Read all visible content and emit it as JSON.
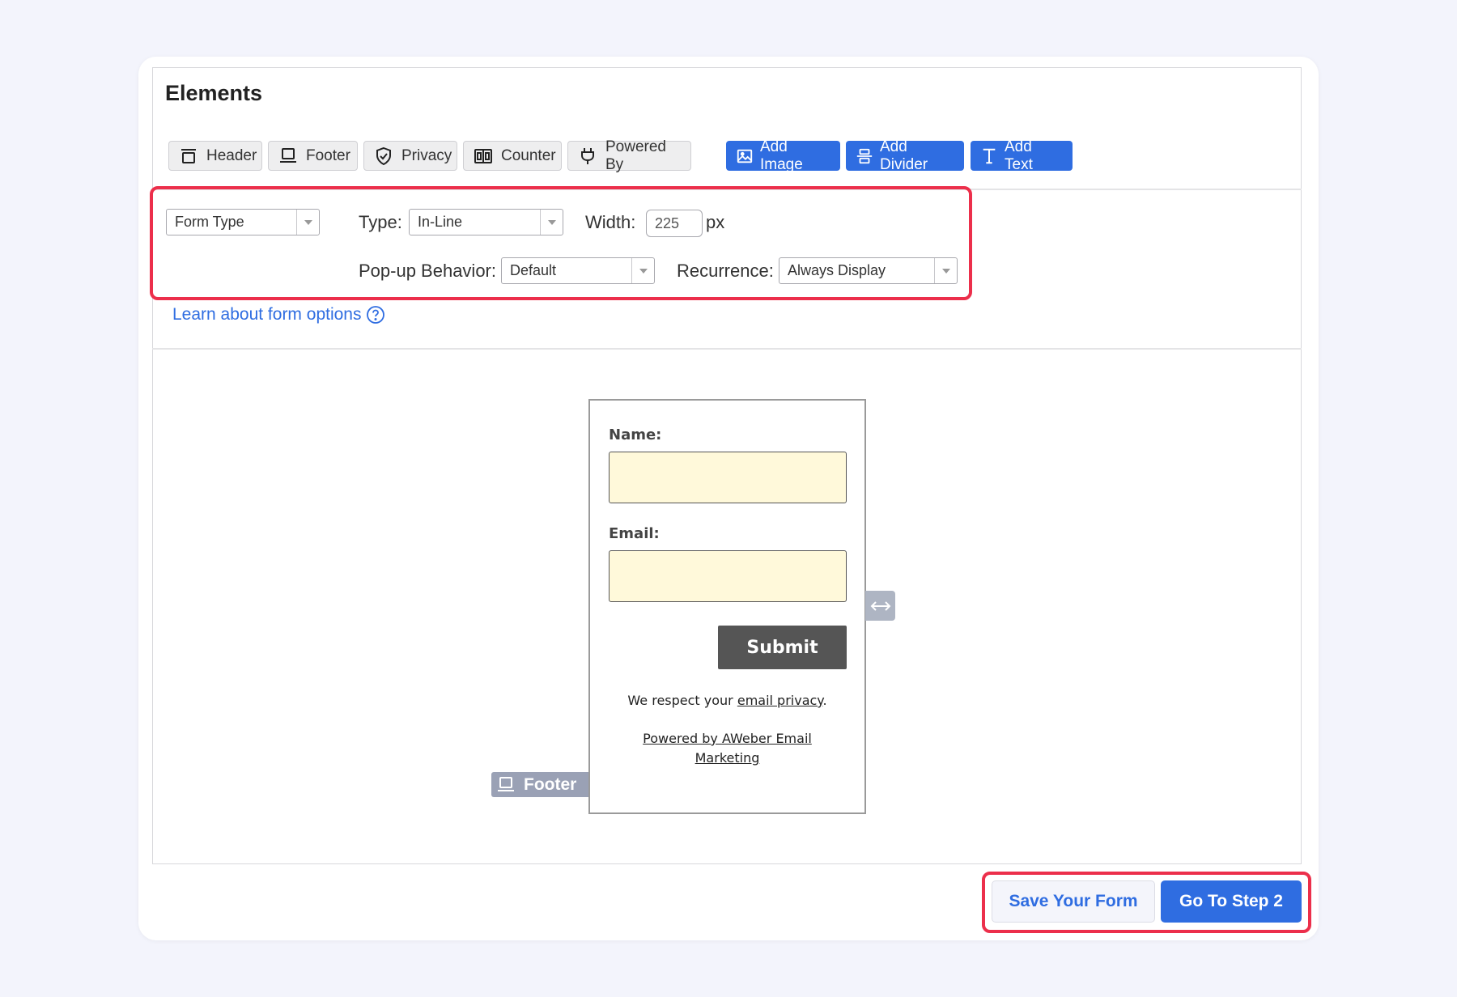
{
  "elements_panel": {
    "title": "Elements",
    "toggles": [
      {
        "label": "Header",
        "icon": "header-icon"
      },
      {
        "label": "Footer",
        "icon": "footer-icon"
      },
      {
        "label": "Privacy",
        "icon": "shield-check-icon"
      },
      {
        "label": "Counter",
        "icon": "counter-icon"
      },
      {
        "label": "Powered By",
        "icon": "plug-icon"
      }
    ],
    "add_buttons": [
      {
        "label": "Add Image",
        "icon": "image-icon"
      },
      {
        "label": "Add Divider",
        "icon": "divider-icon"
      },
      {
        "label": "Add Text",
        "icon": "text-icon"
      }
    ]
  },
  "form_options": {
    "form_type": {
      "value": "Form Type"
    },
    "type": {
      "label": "Type:",
      "value": "In-Line"
    },
    "width": {
      "label": "Width:",
      "value": "225",
      "unit": "px"
    },
    "popup_behavior": {
      "label": "Pop-up Behavior:",
      "value": "Default"
    },
    "recurrence": {
      "label": "Recurrence:",
      "value": "Always Display"
    },
    "learn_link": "Learn about form options"
  },
  "form_preview": {
    "name_label": "Name:",
    "email_label": "Email:",
    "submit_label": "Submit",
    "privacy_prefix": "We respect your ",
    "privacy_link": "email privacy",
    "privacy_suffix": ".",
    "powered_by_line1": "Powered by AWeber Email",
    "powered_by_line2": "Marketing",
    "footer_tag": "Footer"
  },
  "actions": {
    "save_label": "Save Your Form",
    "next_label": "Go To Step 2"
  },
  "colors": {
    "accent": "#2f6de1",
    "highlight": "#ec2f4b",
    "input_fill": "#fff9da",
    "submit_fill": "#555555"
  }
}
